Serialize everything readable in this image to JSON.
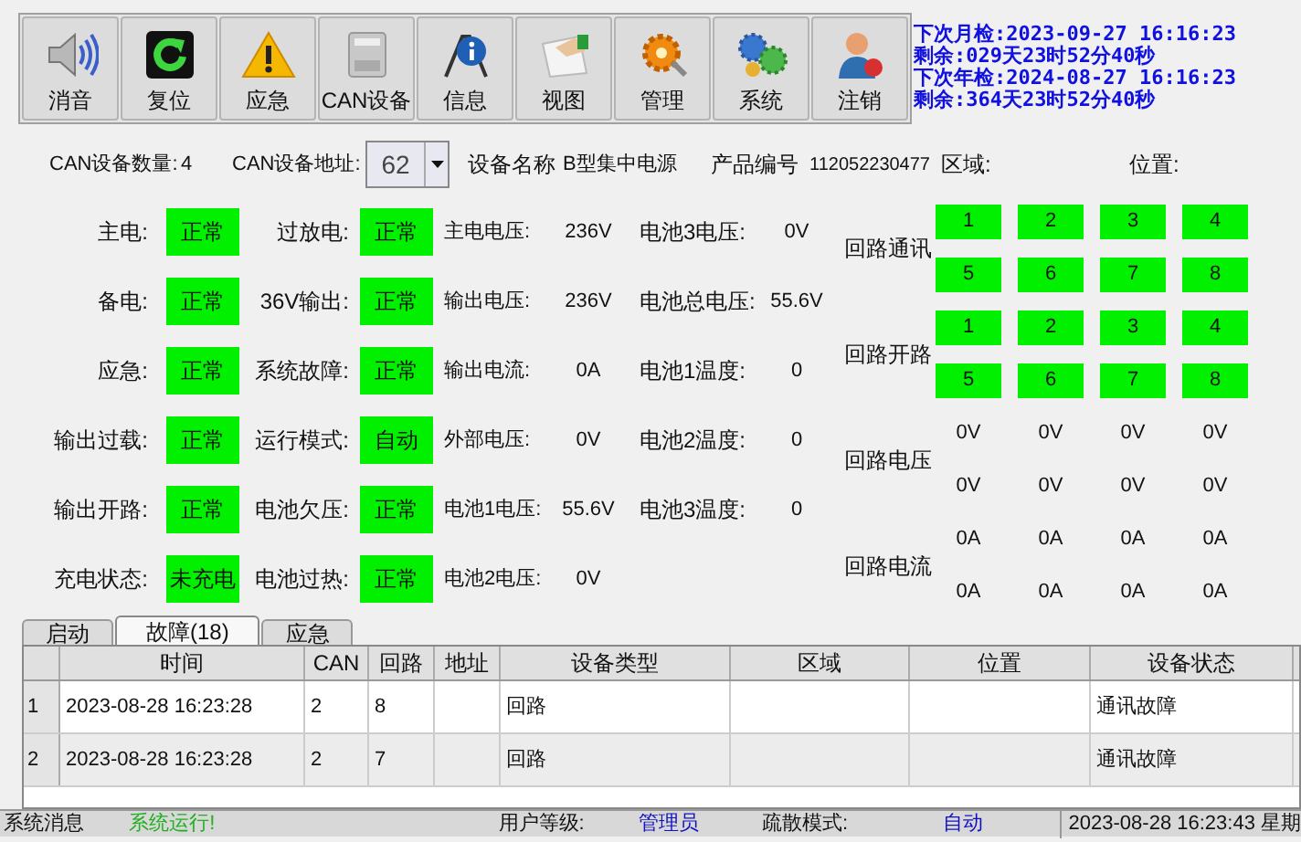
{
  "toolbar": {
    "buttons": [
      {
        "label": "消音",
        "kind": "speaker"
      },
      {
        "label": "复位",
        "kind": "reset"
      },
      {
        "label": "应急",
        "kind": "warning"
      },
      {
        "label": "CAN设备",
        "kind": "device"
      },
      {
        "label": "信息",
        "kind": "info"
      },
      {
        "label": "视图",
        "kind": "view"
      },
      {
        "label": "管理",
        "kind": "manage"
      },
      {
        "label": "系统",
        "kind": "system"
      },
      {
        "label": "注销",
        "kind": "logout"
      }
    ]
  },
  "schedule": [
    "下次月检:2023-09-27 16:16:23",
    "剩余:029天23时52分40秒",
    "下次年检:2024-08-27 16:16:23",
    "剩余:364天23时52分40秒"
  ],
  "device_info": {
    "can_count_label": "CAN设备数量:",
    "can_count": "4",
    "can_address_label": "CAN设备地址:",
    "can_address": "62",
    "name_label": "设备名称",
    "name": "B型集中电源",
    "product_no_label": "产品编号",
    "product_no": "112052230477",
    "area_label": "区域:",
    "position_label": "位置:"
  },
  "status_rows": [
    {
      "label1": "主电:",
      "status1": "正常",
      "label2": "过放电:",
      "status2": "正常",
      "label3": "主电电压:",
      "value3": "236V",
      "label4": "电池3电压:",
      "value4": "0V"
    },
    {
      "label1": "备电:",
      "status1": "正常",
      "label2": "36V输出:",
      "status2": "正常",
      "label3": "输出电压:",
      "value3": "236V",
      "label4": "电池总电压:",
      "value4": "55.6V"
    },
    {
      "label1": "应急:",
      "status1": "正常",
      "label2": "系统故障:",
      "status2": "正常",
      "label3": "输出电流:",
      "value3": "0A",
      "label4": "电池1温度:",
      "value4": "0"
    },
    {
      "label1": "输出过载:",
      "status1": "正常",
      "label2": "运行模式:",
      "status2": "自动",
      "label3": "外部电压:",
      "value3": "0V",
      "label4": "电池2温度:",
      "value4": "0"
    },
    {
      "label1": "输出开路:",
      "status1": "正常",
      "label2": "电池欠压:",
      "status2": "正常",
      "label3": "电池1电压:",
      "value3": "55.6V",
      "label4": "电池3温度:",
      "value4": "0"
    },
    {
      "label1": "充电状态:",
      "status1": "未充电",
      "label2": "电池过热:",
      "status2": "正常",
      "label3": "电池2电压:",
      "value3": "0V"
    }
  ],
  "loops": [
    {
      "label": "回路通讯",
      "kind": "boxes",
      "cells": [
        "1",
        "2",
        "3",
        "4",
        "5",
        "6",
        "7",
        "8"
      ]
    },
    {
      "label": "回路开路",
      "kind": "boxes",
      "cells": [
        "1",
        "2",
        "3",
        "4",
        "5",
        "6",
        "7",
        "8"
      ]
    },
    {
      "label": "回路电压",
      "kind": "values",
      "cells": [
        "0V",
        "0V",
        "0V",
        "0V",
        "0V",
        "0V",
        "0V",
        "0V"
      ]
    },
    {
      "label": "回路电流",
      "kind": "values",
      "cells": [
        "0A",
        "0A",
        "0A",
        "0A",
        "0A",
        "0A",
        "0A",
        "0A"
      ]
    }
  ],
  "tabs": [
    {
      "label": "启动",
      "selected": false
    },
    {
      "label": "故障(18)",
      "selected": true
    },
    {
      "label": "应急",
      "selected": false
    }
  ],
  "table": {
    "columns": [
      "时间",
      "CAN",
      "回路",
      "地址",
      "设备类型",
      "区域",
      "位置",
      "设备状态"
    ],
    "rows": [
      {
        "index": "1",
        "time": "2023-08-28 16:23:28",
        "can": "2",
        "loop": "8",
        "type": "回路",
        "status": "通讯故障"
      },
      {
        "index": "2",
        "time": "2023-08-28 16:23:28",
        "can": "2",
        "loop": "7",
        "type": "回路",
        "status": "通讯故障"
      }
    ]
  },
  "status_bar": [
    {
      "text": "系统消息",
      "kind": "label"
    },
    {
      "text": "系统运行!",
      "kind": "ok"
    },
    {
      "text": "用户等级:",
      "kind": "label"
    },
    {
      "text": "管理员",
      "kind": "value"
    },
    {
      "text": "疏散模式:",
      "kind": "label"
    },
    {
      "text": "自动",
      "kind": "value"
    },
    {
      "text": "2023-08-28 16:23:43 星期",
      "kind": "time"
    }
  ]
}
